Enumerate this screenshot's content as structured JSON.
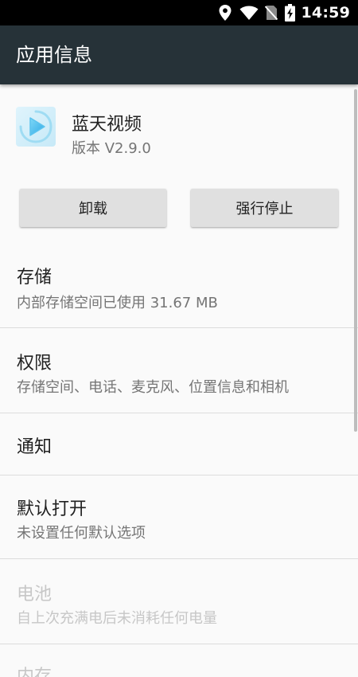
{
  "status_bar": {
    "time": "14:59",
    "icons": [
      "location-icon",
      "wifi-icon",
      "no-sim-icon",
      "battery-charging-icon"
    ]
  },
  "app_bar": {
    "title": "应用信息"
  },
  "app": {
    "name": "蓝天视频",
    "version": "版本 V2.9.0",
    "icon": "app-icon"
  },
  "buttons": {
    "uninstall": "卸载",
    "force_stop": "强行停止"
  },
  "items": [
    {
      "title": "存储",
      "summary": "内部存储空间已使用 31.67 MB",
      "enabled": true
    },
    {
      "title": "权限",
      "summary": "存储空间、电话、麦克风、位置信息和相机",
      "enabled": true
    },
    {
      "title": "通知",
      "summary": "",
      "enabled": true
    },
    {
      "title": "默认打开",
      "summary": "未设置任何默认选项",
      "enabled": true
    },
    {
      "title": "电池",
      "summary": "自上次充满电后未消耗任何电量",
      "enabled": false
    },
    {
      "title": "内存",
      "summary": "",
      "enabled": false
    }
  ],
  "colors": {
    "app_bar": "#263238",
    "status_bar": "#000000",
    "background": "#fafafa",
    "button": "#e0e0e0",
    "disabled_text": "#c7c7c7"
  }
}
